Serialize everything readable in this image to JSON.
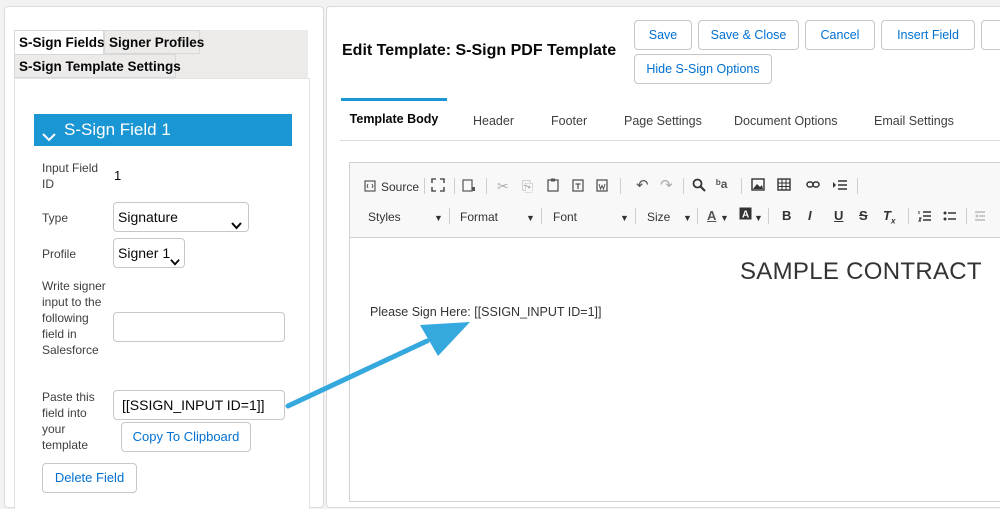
{
  "left": {
    "tabs": [
      "S-Sign Fields",
      "Signer Profiles",
      "S-Sign Template Settings"
    ],
    "field_header": "S-Sign Field 1",
    "fields": {
      "input_id_label": "Input Field ID",
      "input_id_value": "1",
      "type_label": "Type",
      "type_value": "Signature",
      "profile_label": "Profile",
      "profile_value": "Signer 1",
      "write_label": "Write signer input to the following field in Salesforce",
      "write_value": "",
      "paste_label": "Paste this field into your template",
      "paste_value": "[[SSIGN_INPUT ID=1]]"
    },
    "copy_button": "Copy To Clipboard",
    "delete_button": "Delete Field"
  },
  "right": {
    "title": "Edit Template: S-Sign PDF Template",
    "buttons": [
      "Save",
      "Save & Close",
      "Cancel",
      "Insert Field",
      "Hide S-Sign Options"
    ],
    "tabs": [
      "Template Body",
      "Header",
      "Footer",
      "Page Settings",
      "Document Options",
      "Email Settings"
    ],
    "editor": {
      "source_label": "Source",
      "styles_label": "Styles",
      "format_label": "Format",
      "font_label": "Font",
      "size_label": "Size",
      "contract_title": "SAMPLE CONTRACT",
      "sign_line": "Please Sign Here: [[SSIGN_INPUT ID=1]]"
    }
  },
  "colors": {
    "accent": "#1b96d4",
    "link": "#0070d2",
    "arrow": "#35a8dd"
  }
}
